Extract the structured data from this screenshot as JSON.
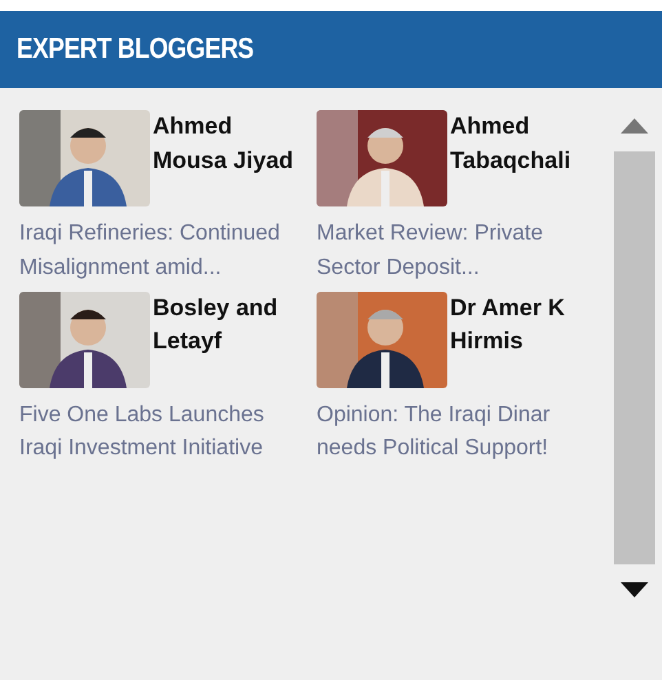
{
  "header": {
    "title": "EXPERT BLOGGERS"
  },
  "bloggers": [
    {
      "name": "Ahmed Mousa Jiyad",
      "title": "Iraqi Refineries: Continued Misalignment amid..."
    },
    {
      "name": "Ahmed Tabaqchali",
      "title": "Market Review: Private Sector Deposit..."
    },
    {
      "name": "Bosley and Letayf",
      "title": "Five One Labs Launches Iraqi Investment Initiative"
    },
    {
      "name": "Dr Amer K Hirmis",
      "title": "Opinion: The Iraqi Dinar needs Political Support!"
    }
  ]
}
